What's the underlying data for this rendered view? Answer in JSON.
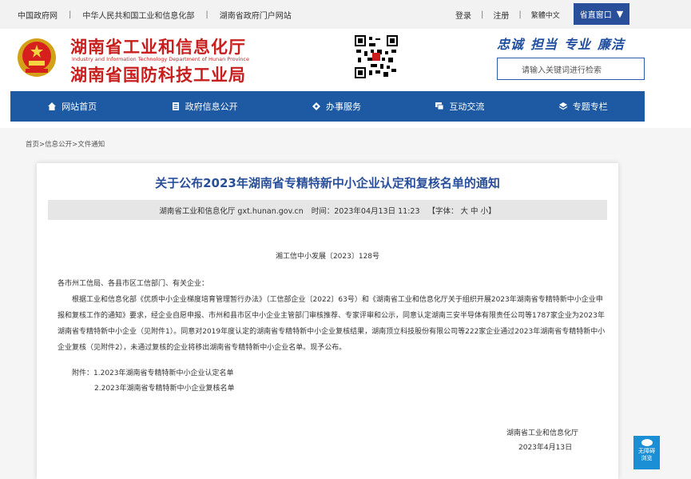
{
  "topbar": {
    "links": [
      "中国政府网",
      "中华人民共和国工业和信息化部",
      "湖南省政府门户网站"
    ],
    "login": "登录",
    "register": "注册",
    "lang": "繁體中文",
    "province_window": "省直窗口"
  },
  "header": {
    "title_cn_1": "湖南省工业和信息化厅",
    "title_en": "Industry and Information Technology Department of Hunan Province",
    "title_cn_2": "湖南省国防科技工业局",
    "slogan": [
      "忠诚",
      "担当",
      "专业",
      "廉洁"
    ],
    "search_placeholder": "请输入关键词进行检索"
  },
  "nav": [
    {
      "label": "网站首页",
      "icon": "home-icon"
    },
    {
      "label": "政府信息公开",
      "icon": "document-icon"
    },
    {
      "label": "办事服务",
      "icon": "service-icon"
    },
    {
      "label": "互动交流",
      "icon": "chat-icon"
    },
    {
      "label": "专题专栏",
      "icon": "layers-icon"
    }
  ],
  "breadcrumb": "首页>信息公开>文件通知",
  "article": {
    "title": "关于公布2023年湖南省专精特新中小企业认定和复核名单的通知",
    "meta_source": "湖南省工业和信息化厅 gxt.hunan.gov.cn",
    "meta_time": "时间：2023年04月13日 11:23",
    "meta_font": "【字体： 大 中 小】",
    "doc_no": "湘工信中小发展〔2023〕128号",
    "salutation": "各市州工信局、各县市区工信部门、有关企业：",
    "body": "根据工业和信息化部《优质中小企业梯度培育管理暂行办法》（工信部企业〔2022〕63号）和《湖南省工业和信息化厅关于组织开展2023年湖南省专精特新中小企业申报和复核工作的通知》要求，经企业自愿申报、市州和县市区中小企业主管部门审核推荐、专家评审和公示，同意认定湖南三安半导体有限责任公司等1787家企业为2023年湖南省专精特新中小企业（见附件1）。同意对2019年度认定的湖南省专精特新中小企业复核结果，湖南顶立科技股份有限公司等222家企业通过2023年湖南省专精特新中小企业复核（见附件2），未通过复核的企业将移出湖南省专精特新中小企业名单。现予公布。",
    "attachment_1": "附件：1.2023年湖南省专精特新中小企业认定名单",
    "attachment_2": "2.2023年湖南省专精特新中小企业复核名单",
    "sign_org": "湖南省工业和信息化厅",
    "sign_date": "2023年4月13日"
  },
  "accessibility": {
    "label_1": "无障碍",
    "label_2": "浏览"
  },
  "colors": {
    "brand_red": "#c81e1e",
    "nav_blue": "#1d5aa3",
    "title_blue": "#2a4f9a"
  }
}
